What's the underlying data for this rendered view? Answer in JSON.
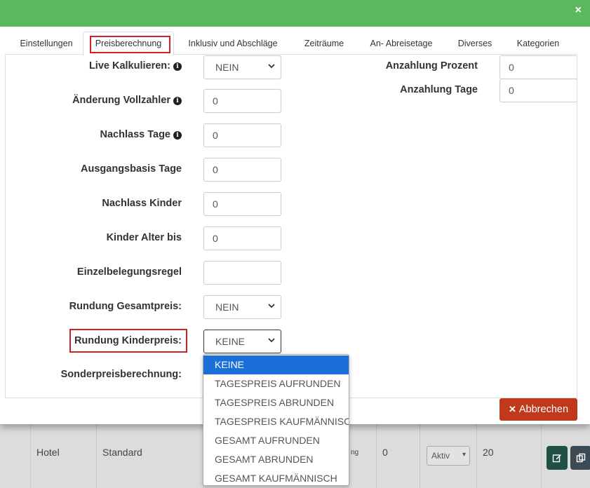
{
  "modal": {
    "close_label": "×",
    "tabs": [
      {
        "label": "Einstellungen"
      },
      {
        "label": "Preisberechnung"
      },
      {
        "label": "Inklusiv und Abschläge"
      },
      {
        "label": "Zeiträume"
      },
      {
        "label": "An- Abreisetage"
      },
      {
        "label": "Diverses"
      },
      {
        "label": "Kategorien"
      }
    ],
    "active_tab": "Preisberechnung",
    "fields": {
      "live_kalkulieren": {
        "label": "Live Kalkulieren:",
        "value": "NEIN"
      },
      "aenderung_vollzahler": {
        "label": "Änderung Vollzahler",
        "value": "0"
      },
      "nachlass_tage": {
        "label": "Nachlass Tage",
        "value": "0"
      },
      "ausgangsbasis_tage": {
        "label": "Ausgangsbasis Tage",
        "value": "0"
      },
      "nachlass_kinder": {
        "label": "Nachlass Kinder",
        "value": "0"
      },
      "kinder_alter_bis": {
        "label": "Kinder Alter bis",
        "value": "0"
      },
      "einzelbelegungsregel": {
        "label": "Einzelbelegungsregel",
        "value": ""
      },
      "rundung_gesamtpreis": {
        "label": "Rundung Gesamtpreis:",
        "value": "NEIN"
      },
      "rundung_kinderpreis": {
        "label": "Rundung Kinderpreis:",
        "value": "KEINE"
      },
      "sonderpreisberechnung": {
        "label": "Sonderpreisberechnung:"
      },
      "anzahlung_prozent": {
        "label": "Anzahlung Prozent",
        "value": "0"
      },
      "anzahlung_tage": {
        "label": "Anzahlung Tage",
        "value": "0"
      }
    },
    "info_glyph": "i",
    "cancel_label": "Abbrechen",
    "cancel_glyph": "✕"
  },
  "dropdown": {
    "options": [
      "KEINE",
      "TAGESPREIS AUFRUNDEN",
      "TAGESPREIS ABRUNDEN",
      "TAGESPREIS KAUFMÄNNISCH",
      "GESAMT AUFRUNDEN",
      "GESAMT ABRUNDEN",
      "GESAMT KAUFMÄNNISCH"
    ],
    "selected": "KEINE"
  },
  "background_row": {
    "type": "Hotel",
    "category": "Standard",
    "truncated_text": "ng",
    "number": "0",
    "status": "Aktiv",
    "count": "20"
  },
  "colors": {
    "header": "#5cb85c",
    "cancel_button": "#c0391b",
    "highlight_box": "#d42020",
    "dropdown_selected": "#1a6fd8"
  }
}
